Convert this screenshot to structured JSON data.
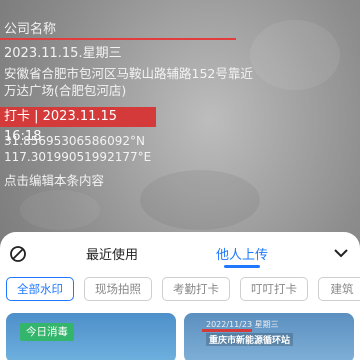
{
  "watermark": {
    "company": "公司名称",
    "date": "2023.11.15.星期三",
    "address": "安徽省合肥市包河区马鞍山路辅路152号靠近万达广场(合肥包河店)",
    "stamp": "打卡 | 2023.11.15 16:18",
    "latitude": "31.85695306586092°N",
    "longitude": "117.30199051992177°E",
    "edit_hint": "点击编辑本条内容"
  },
  "sheet": {
    "tabs": [
      {
        "label": "最近使用",
        "active": false
      },
      {
        "label": "他人上传",
        "active": true
      }
    ],
    "chips": [
      {
        "label": "全部水印",
        "active": true
      },
      {
        "label": "现场拍照",
        "active": false
      },
      {
        "label": "考勤打卡",
        "active": false
      },
      {
        "label": "叮叮打卡",
        "active": false
      },
      {
        "label": "建筑",
        "active": false
      }
    ],
    "thumbnails": [
      {
        "badge": "今日消毒"
      },
      {
        "date": "2022/11/23 星期三",
        "label": "重庆市新能源循环站"
      }
    ]
  },
  "colors": {
    "accent": "#1f78ff",
    "stamp_red": "#d43a3a",
    "badge_green": "#33b56b"
  }
}
